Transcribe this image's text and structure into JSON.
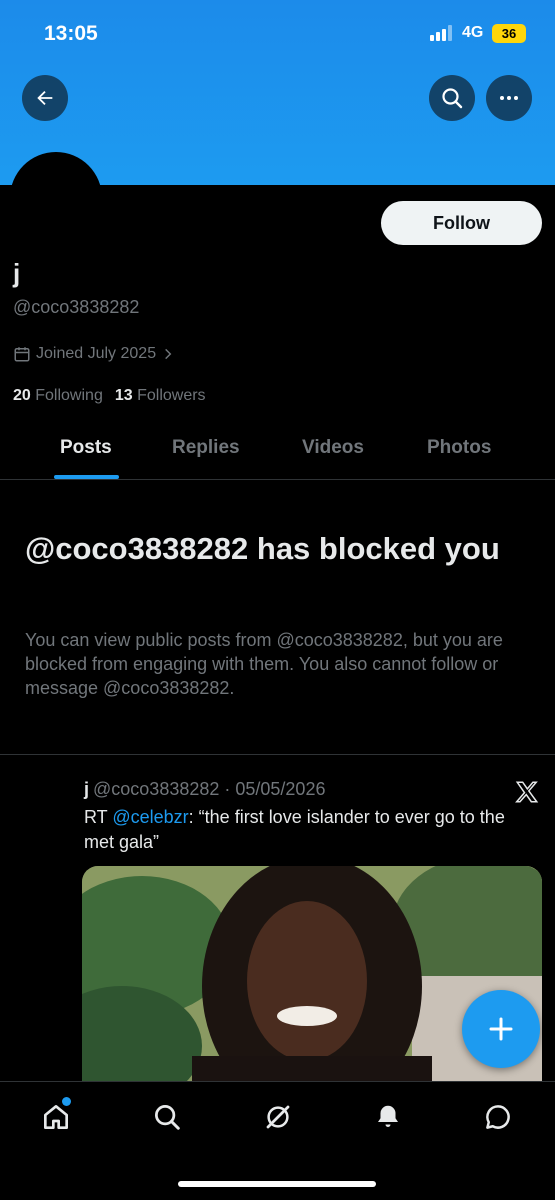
{
  "status_bar": {
    "time": "13:05",
    "network": "4G",
    "battery": "36"
  },
  "header": {
    "back_icon": "arrow-left-icon",
    "search_icon": "search-icon",
    "more_icon": "more-horizontal-icon"
  },
  "profile": {
    "follow_label": "Follow",
    "display_name": "j",
    "handle": "@coco3838282",
    "joined": "Joined July 2025",
    "following_count": "20",
    "following_label": "Following",
    "followers_count": "13",
    "followers_label": "Followers"
  },
  "tabs": [
    {
      "label": "Posts",
      "active": true
    },
    {
      "label": "Replies",
      "active": false
    },
    {
      "label": "Videos",
      "active": false
    },
    {
      "label": "Photos",
      "active": false
    }
  ],
  "blocked": {
    "title": "@coco3838282 has blocked you",
    "description": "You can view public posts from @coco3838282, but you are blocked from engaging with them. You also cannot follow or message @coco3838282."
  },
  "tweet": {
    "name": "j",
    "meta": "@coco3838282 · 05/05/2026",
    "rt_prefix": "RT ",
    "mention": "@celebzr",
    "text": ": “the first love islander to ever go to the met gala”"
  },
  "colors": {
    "accent": "#1d9bf0",
    "banner": "#1d9bf0",
    "background": "#000000",
    "battery": "#ffd60a"
  },
  "bottom_nav": [
    "home-icon",
    "search-icon",
    "grok-icon",
    "bell-icon",
    "messages-icon"
  ]
}
